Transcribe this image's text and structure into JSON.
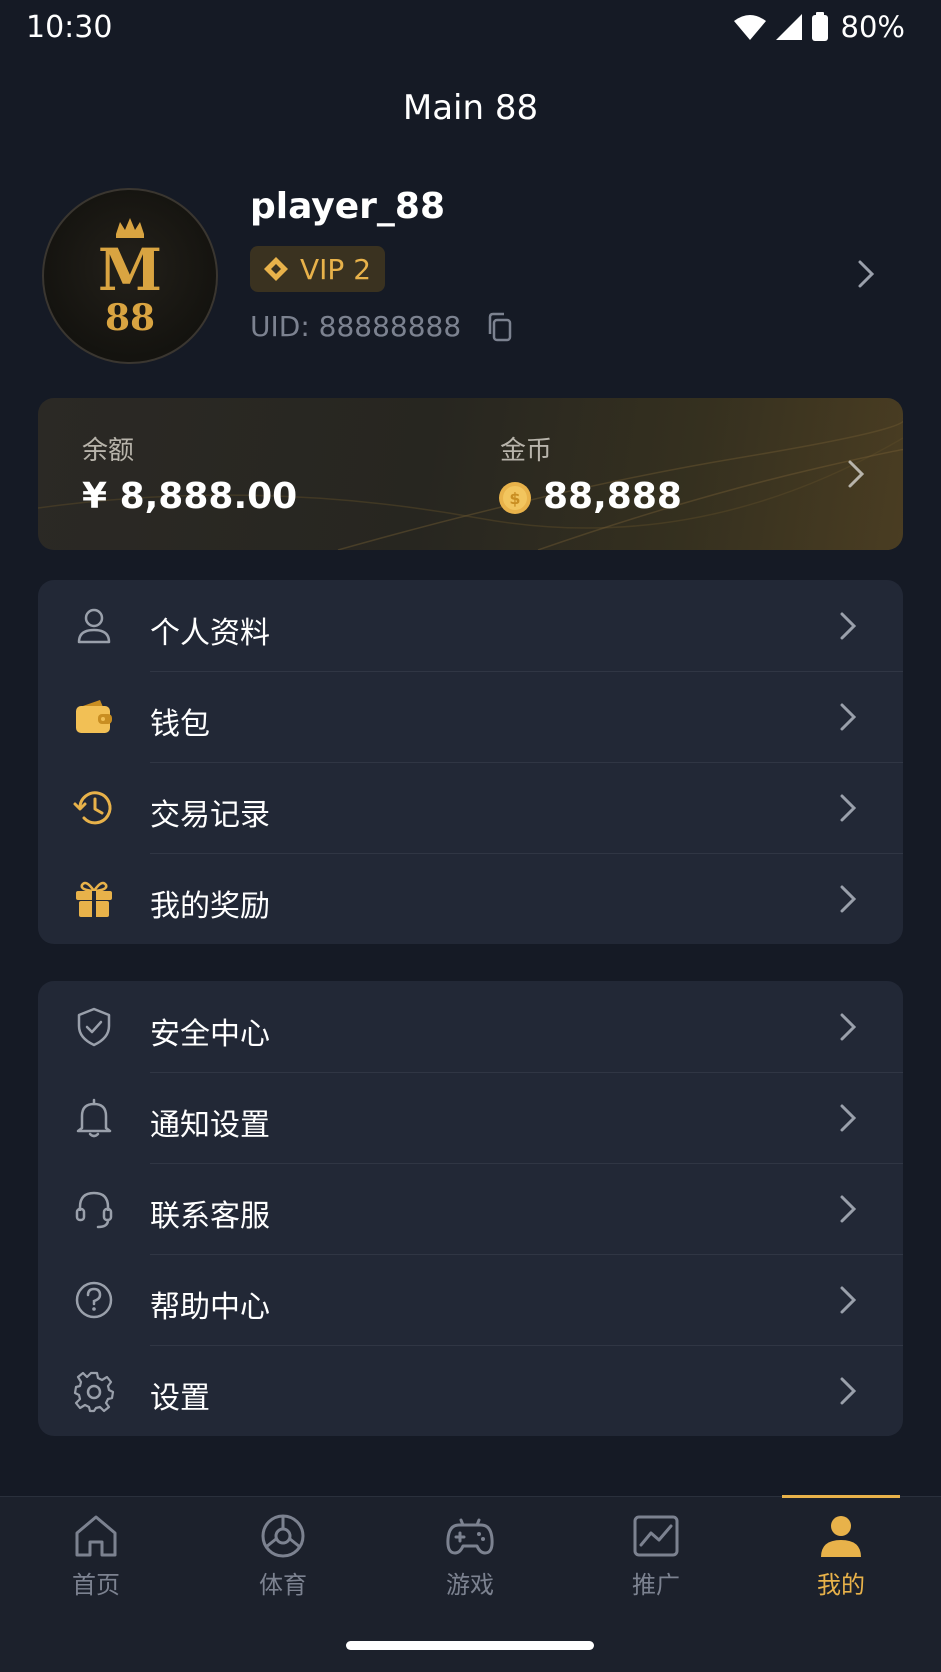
{
  "status_bar": {
    "time": "10:30",
    "battery_percent": "80%"
  },
  "header": {
    "title": "Main 88"
  },
  "profile": {
    "avatar_logo": "M 88",
    "username": "player_88",
    "vip_label": "VIP 2",
    "uid": "UID: 88888888"
  },
  "balance": {
    "balance_label": "余额",
    "balance_value": "¥ 8,888.00",
    "coins_label": "金币",
    "coins_value": "88,888"
  },
  "menu_group_1": [
    {
      "label": "个人资料",
      "icon": "user-icon"
    },
    {
      "label": "钱包",
      "icon": "wallet-icon"
    },
    {
      "label": "交易记录",
      "icon": "history-icon"
    },
    {
      "label": "我的奖励",
      "icon": "gift-icon"
    }
  ],
  "menu_group_2": [
    {
      "label": "安全中心",
      "icon": "shield-icon"
    },
    {
      "label": "通知设置",
      "icon": "bell-icon"
    },
    {
      "label": "联系客服",
      "icon": "headset-icon"
    },
    {
      "label": "帮助中心",
      "icon": "help-icon"
    },
    {
      "label": "设置",
      "icon": "gear-icon"
    }
  ],
  "bottom_nav": [
    {
      "label": "首页",
      "icon": "home-icon",
      "active": false
    },
    {
      "label": "体育",
      "icon": "ball-icon",
      "active": false
    },
    {
      "label": "游戏",
      "icon": "gamepad-icon",
      "active": false
    },
    {
      "label": "推广",
      "icon": "chart-icon",
      "active": false
    },
    {
      "label": "我的",
      "icon": "profile-icon",
      "active": true
    }
  ],
  "colors": {
    "background": "#151a25",
    "card": "#222836",
    "accent_gold": "#e8b24a",
    "muted_text": "#7c8290"
  }
}
